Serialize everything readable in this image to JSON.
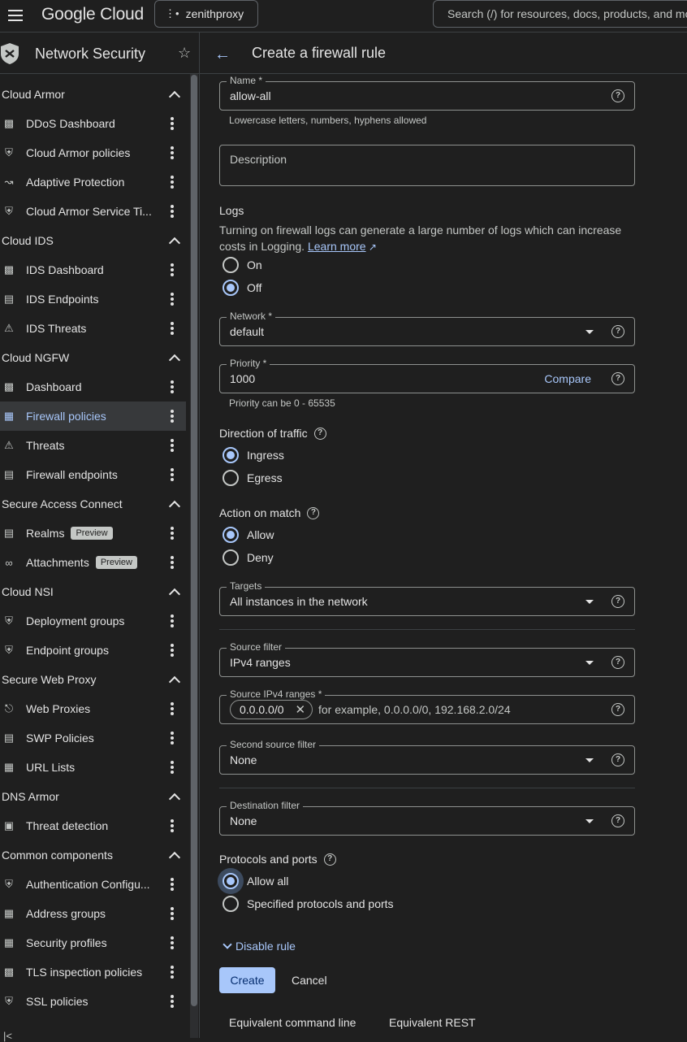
{
  "topbar": {
    "logo": "Google Cloud",
    "project": "zenithproxy",
    "search_placeholder": "Search (/) for resources, docs, products, and mo"
  },
  "sidebar": {
    "title": "Network Security",
    "sections": [
      {
        "label": "Cloud Armor",
        "items": [
          {
            "label": "DDoS Dashboard",
            "icon": "dashboard-icon"
          },
          {
            "label": "Cloud Armor policies",
            "icon": "shield-icon"
          },
          {
            "label": "Adaptive Protection",
            "icon": "chart-icon"
          },
          {
            "label": "Cloud Armor Service Ti...",
            "icon": "shield-icon"
          }
        ]
      },
      {
        "label": "Cloud IDS",
        "items": [
          {
            "label": "IDS Dashboard",
            "icon": "dashboard-icon"
          },
          {
            "label": "IDS Endpoints",
            "icon": "endpoint-icon"
          },
          {
            "label": "IDS Threats",
            "icon": "threat-icon"
          }
        ]
      },
      {
        "label": "Cloud NGFW",
        "items": [
          {
            "label": "Dashboard",
            "icon": "dashboard-icon"
          },
          {
            "label": "Firewall policies",
            "icon": "firewall-icon",
            "active": true
          },
          {
            "label": "Threats",
            "icon": "threat-icon"
          },
          {
            "label": "Firewall endpoints",
            "icon": "endpoint-icon"
          }
        ]
      },
      {
        "label": "Secure Access Connect",
        "items": [
          {
            "label": "Realms",
            "icon": "endpoint-icon",
            "badge": "Preview"
          },
          {
            "label": "Attachments",
            "icon": "attachment-icon",
            "badge": "Preview"
          }
        ]
      },
      {
        "label": "Cloud NSI",
        "items": [
          {
            "label": "Deployment groups",
            "icon": "shield-icon"
          },
          {
            "label": "Endpoint groups",
            "icon": "shield-icon"
          }
        ]
      },
      {
        "label": "Secure Web Proxy",
        "items": [
          {
            "label": "Web Proxies",
            "icon": "proxy-icon"
          },
          {
            "label": "SWP Policies",
            "icon": "list-icon"
          },
          {
            "label": "URL Lists",
            "icon": "folder-icon"
          }
        ]
      },
      {
        "label": "DNS Armor",
        "items": [
          {
            "label": "Threat detection",
            "icon": "monitor-icon"
          }
        ]
      },
      {
        "label": "Common components",
        "items": [
          {
            "label": "Authentication Configu...",
            "icon": "shield-icon"
          },
          {
            "label": "Address groups",
            "icon": "folder-icon"
          },
          {
            "label": "Security profiles",
            "icon": "folder-icon"
          },
          {
            "label": "TLS inspection policies",
            "icon": "dashboard-icon"
          },
          {
            "label": "SSL policies",
            "icon": "shield-icon"
          }
        ]
      }
    ]
  },
  "main": {
    "title": "Create a firewall rule",
    "name_label": "Name *",
    "name_value": "allow-all",
    "name_hint": "Lowercase letters, numbers, hyphens allowed",
    "description_placeholder": "Description",
    "logs_heading": "Logs",
    "logs_text": "Turning on firewall logs can generate a large number of logs which can increase costs in Logging.",
    "learn_more": "Learn more",
    "logs_on": "On",
    "logs_off": "Off",
    "network_label": "Network *",
    "network_value": "default",
    "priority_label": "Priority *",
    "priority_value": "1000",
    "compare": "Compare",
    "priority_hint": "Priority can be 0 - 65535",
    "direction_heading": "Direction of traffic",
    "ingress": "Ingress",
    "egress": "Egress",
    "action_heading": "Action on match",
    "allow": "Allow",
    "deny": "Deny",
    "targets_label": "Targets",
    "targets_value": "All instances in the network",
    "source_filter_label": "Source filter",
    "source_filter_value": "IPv4 ranges",
    "source_ranges_label": "Source IPv4 ranges *",
    "source_range_chip": "0.0.0.0/0",
    "source_range_placeholder": "for example, 0.0.0.0/0, 192.168.2.0/24",
    "second_source_label": "Second source filter",
    "second_source_value": "None",
    "dest_filter_label": "Destination filter",
    "dest_filter_value": "None",
    "protocols_heading": "Protocols and ports",
    "allow_all": "Allow all",
    "specified": "Specified protocols and ports",
    "disable_rule": "Disable rule",
    "create": "Create",
    "cancel": "Cancel",
    "equiv_cmd": "Equivalent command line",
    "equiv_rest": "Equivalent REST"
  }
}
